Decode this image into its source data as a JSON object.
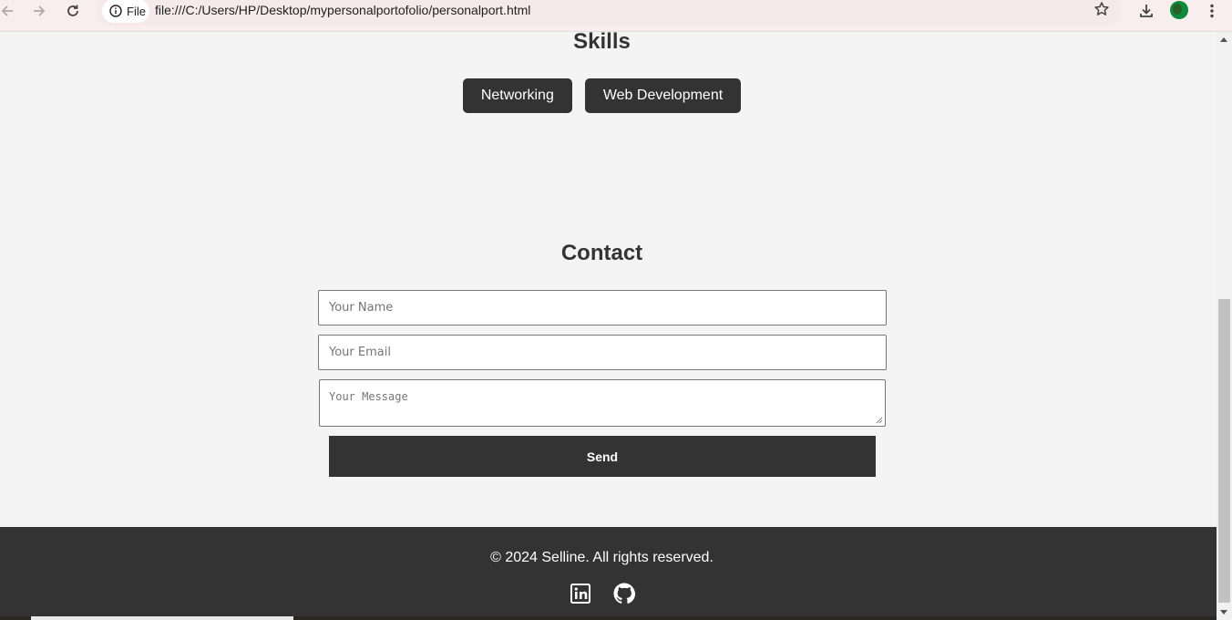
{
  "browser": {
    "site_chip_label": "File",
    "url": "file:///C:/Users/HP/Desktop/mypersonalportofolio/personalport.html"
  },
  "skills": {
    "title": "Skills",
    "items": [
      "Networking",
      "Web Development"
    ]
  },
  "contact": {
    "title": "Contact",
    "name_placeholder": "Your Name",
    "email_placeholder": "Your Email",
    "message_placeholder": "Your Message",
    "send_label": "Send"
  },
  "footer": {
    "copyright": "© 2024 Selline. All rights reserved.",
    "social_icons": [
      "linkedin-icon",
      "github-icon"
    ]
  },
  "colors": {
    "page_bg": "#f4f4f4",
    "dark": "#333333",
    "chrome_bg": "#f8eeee"
  }
}
